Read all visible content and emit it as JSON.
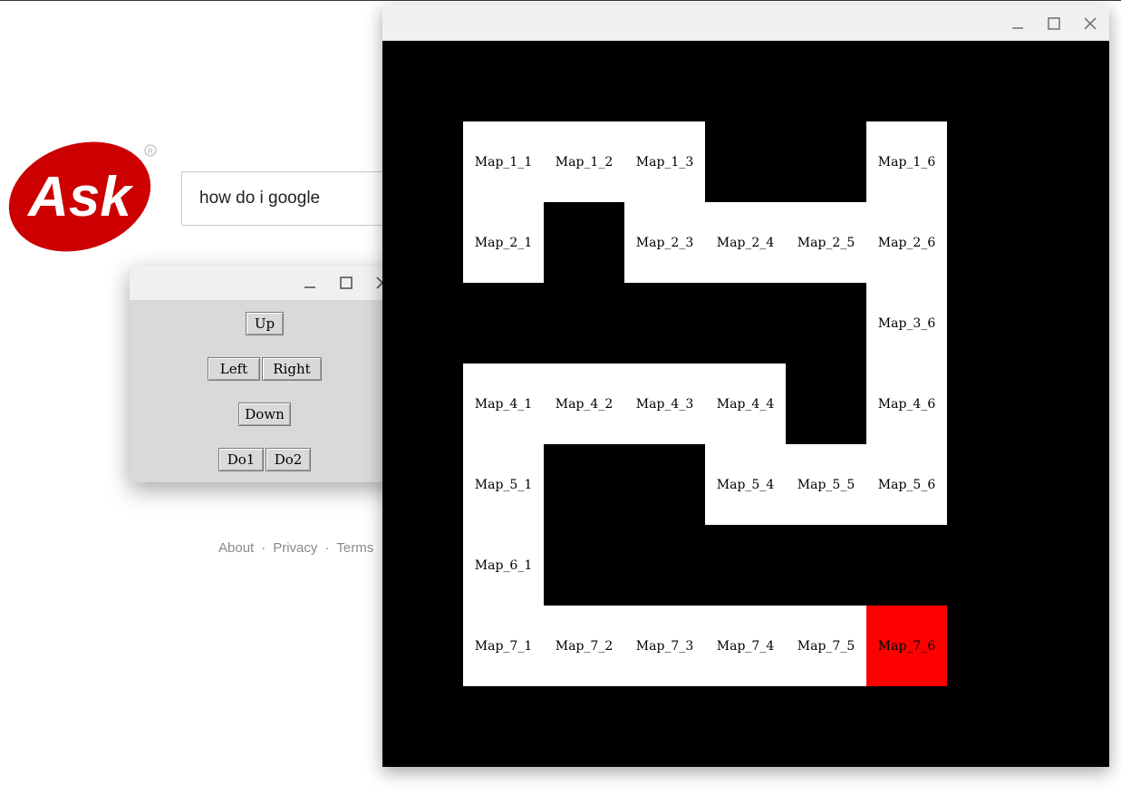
{
  "browser": {
    "search_value": "how do i google",
    "logo_text": "Ask",
    "logo_color": "#cc0000",
    "footer_links": [
      "About",
      "Privacy",
      "Terms"
    ],
    "footer_separator": "·"
  },
  "controls_window": {
    "titlebar_icons": [
      "minimize-icon",
      "maximize-icon",
      "close-icon"
    ],
    "buttons": {
      "up": "Up",
      "left": "Left",
      "right": "Right",
      "down": "Down",
      "do1": "Do1",
      "do2": "Do2"
    }
  },
  "map_window": {
    "titlebar_icons": [
      "minimize-icon",
      "maximize-icon",
      "close-icon"
    ],
    "background_color": "#000000",
    "cell_color": "#ffffff",
    "highlight_color": "#ff0000",
    "cells": [
      {
        "label": "Map_1_1",
        "row": 1,
        "col": 1
      },
      {
        "label": "Map_1_2",
        "row": 1,
        "col": 2
      },
      {
        "label": "Map_1_3",
        "row": 1,
        "col": 3
      },
      {
        "label": "Map_1_6",
        "row": 1,
        "col": 6
      },
      {
        "label": "Map_2_1",
        "row": 2,
        "col": 1
      },
      {
        "label": "Map_2_3",
        "row": 2,
        "col": 3
      },
      {
        "label": "Map_2_4",
        "row": 2,
        "col": 4
      },
      {
        "label": "Map_2_5",
        "row": 2,
        "col": 5
      },
      {
        "label": "Map_2_6",
        "row": 2,
        "col": 6
      },
      {
        "label": "Map_3_6",
        "row": 3,
        "col": 6
      },
      {
        "label": "Map_4_1",
        "row": 4,
        "col": 1
      },
      {
        "label": "Map_4_2",
        "row": 4,
        "col": 2
      },
      {
        "label": "Map_4_3",
        "row": 4,
        "col": 3
      },
      {
        "label": "Map_4_4",
        "row": 4,
        "col": 4
      },
      {
        "label": "Map_4_6",
        "row": 4,
        "col": 6
      },
      {
        "label": "Map_5_1",
        "row": 5,
        "col": 1
      },
      {
        "label": "Map_5_4",
        "row": 5,
        "col": 4
      },
      {
        "label": "Map_5_5",
        "row": 5,
        "col": 5
      },
      {
        "label": "Map_5_6",
        "row": 5,
        "col": 6
      },
      {
        "label": "Map_6_1",
        "row": 6,
        "col": 1
      },
      {
        "label": "Map_7_1",
        "row": 7,
        "col": 1
      },
      {
        "label": "Map_7_2",
        "row": 7,
        "col": 2
      },
      {
        "label": "Map_7_3",
        "row": 7,
        "col": 3
      },
      {
        "label": "Map_7_4",
        "row": 7,
        "col": 4
      },
      {
        "label": "Map_7_5",
        "row": 7,
        "col": 5
      },
      {
        "label": "Map_7_6",
        "row": 7,
        "col": 6,
        "highlighted": true
      }
    ]
  }
}
